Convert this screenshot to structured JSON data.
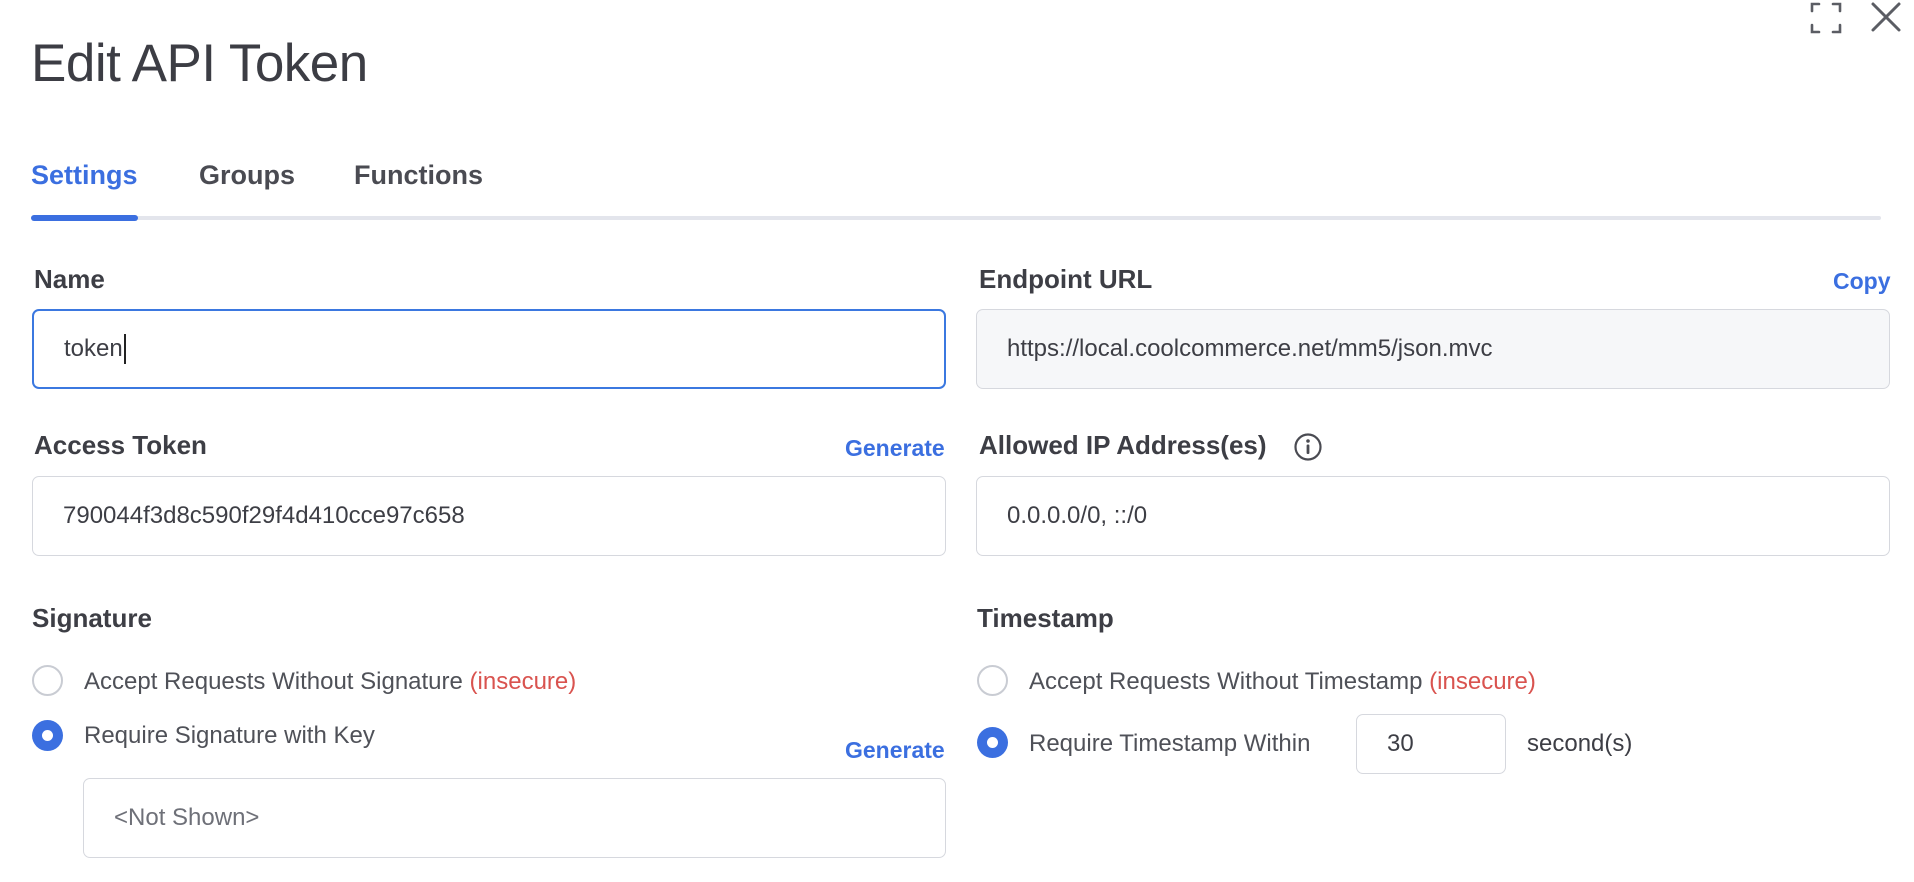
{
  "dialog": {
    "title": "Edit API Token",
    "expand_icon": "expand-icon",
    "close_icon": "close-icon"
  },
  "tabs": [
    {
      "label": "Settings",
      "active": true
    },
    {
      "label": "Groups",
      "active": false
    },
    {
      "label": "Functions",
      "active": false
    }
  ],
  "name": {
    "label": "Name",
    "value": "token"
  },
  "endpoint": {
    "label": "Endpoint URL",
    "copy_label": "Copy",
    "value": "https://local.coolcommerce.net/mm5/json.mvc"
  },
  "access_token": {
    "label": "Access Token",
    "generate_label": "Generate",
    "value": "790044f3d8c590f29f4d410cce97c658"
  },
  "allowed_ips": {
    "label": "Allowed IP Address(es)",
    "info_icon": "info-icon",
    "value": "0.0.0.0/0, ::/0"
  },
  "signature": {
    "heading": "Signature",
    "option_without": {
      "text": "Accept Requests Without Signature",
      "flag": "(insecure)",
      "checked": false
    },
    "option_key": {
      "text": "Require Signature with Key",
      "checked": true
    },
    "generate_label": "Generate",
    "key_value": "<Not Shown>"
  },
  "timestamp": {
    "heading": "Timestamp",
    "option_without": {
      "text": "Accept Requests Without Timestamp",
      "flag": "(insecure)",
      "checked": false
    },
    "option_within": {
      "text": "Require Timestamp Within",
      "checked": true
    },
    "seconds_value": "30",
    "unit_label": "second(s)"
  },
  "colors": {
    "accent": "#3b6fe0",
    "danger": "#d9534f",
    "text": "#3d3e45",
    "border": "#d6d8de"
  }
}
